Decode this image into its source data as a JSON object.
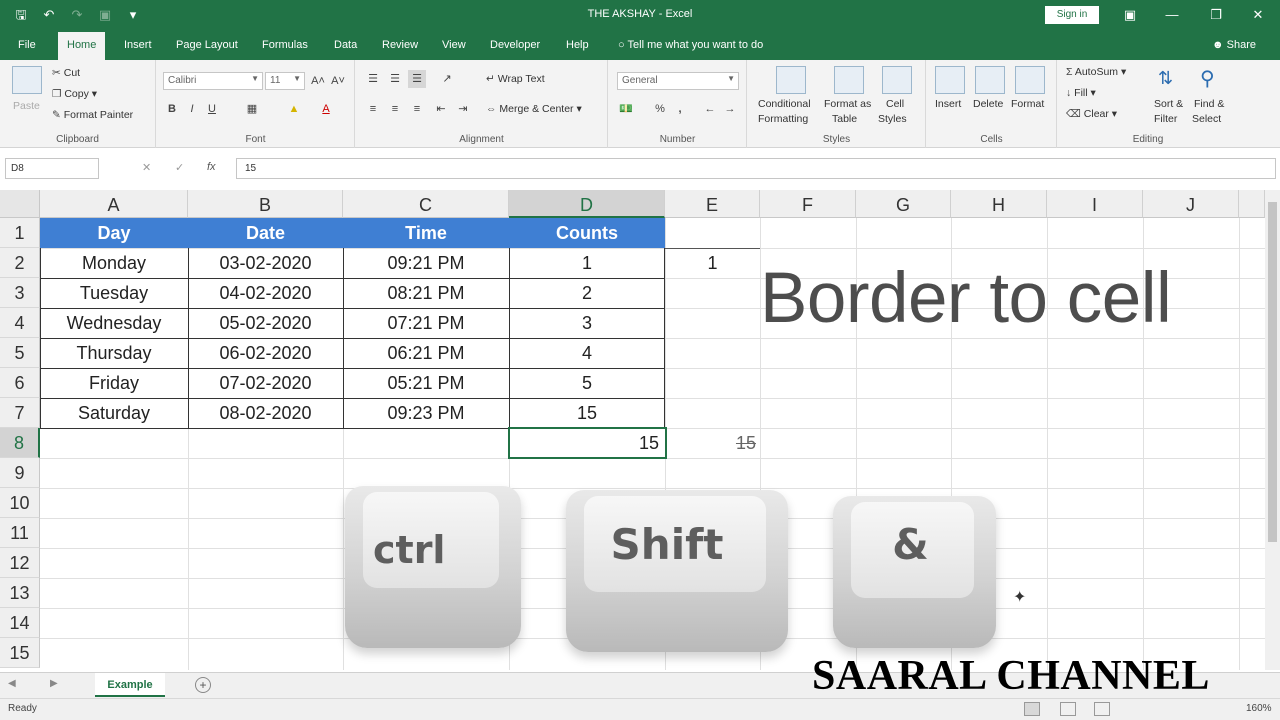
{
  "window": {
    "title": "THE AKSHAY - Excel",
    "signin": "Sign in",
    "qat_icons": [
      "save-icon",
      "undo-icon",
      "redo-icon",
      "camera-icon",
      "customize-icon"
    ]
  },
  "tabs": [
    "File",
    "Home",
    "Insert",
    "Page Layout",
    "Formulas",
    "Data",
    "Review",
    "View",
    "Developer",
    "Help"
  ],
  "tell_me": "Tell me what you want to do",
  "share": "Share",
  "ribbon": {
    "clipboard": {
      "paste": "Paste",
      "cut": "Cut",
      "copy": "Copy",
      "format_painter": "Format Painter",
      "label": "Clipboard"
    },
    "font": {
      "name": "Calibri",
      "size": "11",
      "label": "Font",
      "bold": "B",
      "italic": "I",
      "underline": "U"
    },
    "alignment": {
      "wrap": "Wrap Text",
      "merge": "Merge & Center",
      "label": "Alignment"
    },
    "number": {
      "format": "General",
      "label": "Number",
      "percent": "%",
      "comma": ","
    },
    "styles": {
      "conditional_1": "Conditional",
      "conditional_2": "Formatting",
      "format_table_1": "Format as",
      "format_table_2": "Table",
      "cell_styles_1": "Cell",
      "cell_styles_2": "Styles",
      "label": "Styles"
    },
    "cells": {
      "insert": "Insert",
      "delete": "Delete",
      "format": "Format",
      "label": "Cells"
    },
    "editing": {
      "autosum": "AutoSum",
      "fill": "Fill",
      "clear": "Clear",
      "sort_1": "Sort &",
      "sort_2": "Filter",
      "find_1": "Find &",
      "find_2": "Select",
      "label": "Editing"
    }
  },
  "formula_bar": {
    "name_box": "D8",
    "cancel": "✕",
    "enter": "✓",
    "fx": "fx",
    "value": "15"
  },
  "columns": [
    "A",
    "B",
    "C",
    "D",
    "E",
    "F",
    "G",
    "H",
    "I",
    "J"
  ],
  "rows": [
    "1",
    "2",
    "3",
    "4",
    "5",
    "6",
    "7",
    "8",
    "9",
    "10",
    "11",
    "12",
    "13",
    "14",
    "15"
  ],
  "table": {
    "headers": [
      "Day",
      "Date",
      "Time",
      "Counts"
    ],
    "rows": [
      [
        "Monday",
        "03-02-2020",
        "09:21 PM",
        "1"
      ],
      [
        "Tuesday",
        "04-02-2020",
        "08:21 PM",
        "2"
      ],
      [
        "Wednesday",
        "05-02-2020",
        "07:21 PM",
        "3"
      ],
      [
        "Thursday",
        "06-02-2020",
        "06:21 PM",
        "4"
      ],
      [
        "Friday",
        "07-02-2020",
        "05:21 PM",
        "5"
      ],
      [
        "Saturday",
        "08-02-2020",
        "09:23 PM",
        "15"
      ]
    ]
  },
  "cells_extra": {
    "e2": "1",
    "d8": "15",
    "e8": "15"
  },
  "overlay": {
    "title": "Border to cell",
    "keys": [
      "ctrl",
      "Shift",
      "&"
    ],
    "channel": "SAARAL CHANNEL"
  },
  "sheet_tab": "Example",
  "status": {
    "ready": "Ready",
    "zoom": "160%"
  },
  "colors": {
    "excel_green": "#217346",
    "header_blue": "#3f7fd3"
  }
}
